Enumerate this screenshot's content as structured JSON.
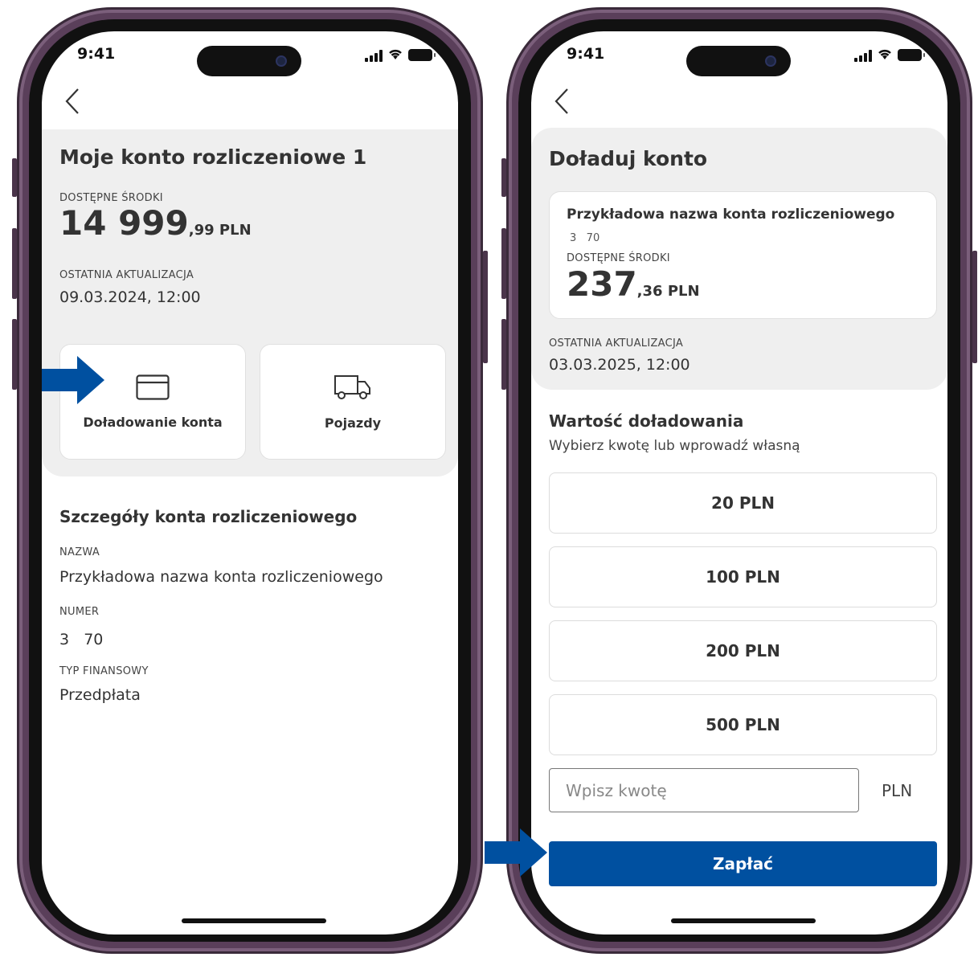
{
  "status": {
    "time": "9:41"
  },
  "colors": {
    "accent": "#0050a0",
    "panel": "#efefef",
    "frame": "#5a3f5a"
  },
  "left": {
    "back_icon": "chevron-left-icon",
    "title": "Moje konto rozliczeniowe 1",
    "balance_label": "DOSTĘPNE ŚRODKI",
    "balance_int": "14 999",
    "balance_dec": ",99 PLN",
    "update_label": "OSTATNIA AKTUALIZACJA",
    "update_value": "09.03.2024, 12:00",
    "tiles": [
      {
        "icon": "credit-card-icon",
        "label": "Doładowanie konta"
      },
      {
        "icon": "truck-icon",
        "label": "Pojazdy"
      }
    ],
    "details_title": "Szczegóły konta rozliczeniowego",
    "name_label": "NAZWA",
    "name_value": "Przykładowa nazwa konta rozliczeniowego",
    "number_label": "NUMER",
    "number_value": "3   70",
    "type_label": "TYP FINANSOWY",
    "type_value": "Przedpłata"
  },
  "right": {
    "back_icon": "chevron-left-icon",
    "title": "Doładuj konto",
    "card": {
      "account_name": "Przykładowa nazwa konta rozliczeniowego",
      "account_number": "3   70",
      "balance_label": "DOSTĘPNE ŚRODKI",
      "balance_int": "237",
      "balance_dec": ",36 PLN"
    },
    "update_label": "OSTATNIA AKTUALIZACJA",
    "update_value": "03.03.2025, 12:00",
    "section_title": "Wartość doładowania",
    "section_sub": "Wybierz kwotę lub wprowadź własną",
    "amounts": [
      "20 PLN",
      "100 PLN",
      "200 PLN",
      "500 PLN"
    ],
    "input_placeholder": "Wpisz kwotę",
    "currency": "PLN",
    "pay_label": "Zapłać"
  }
}
